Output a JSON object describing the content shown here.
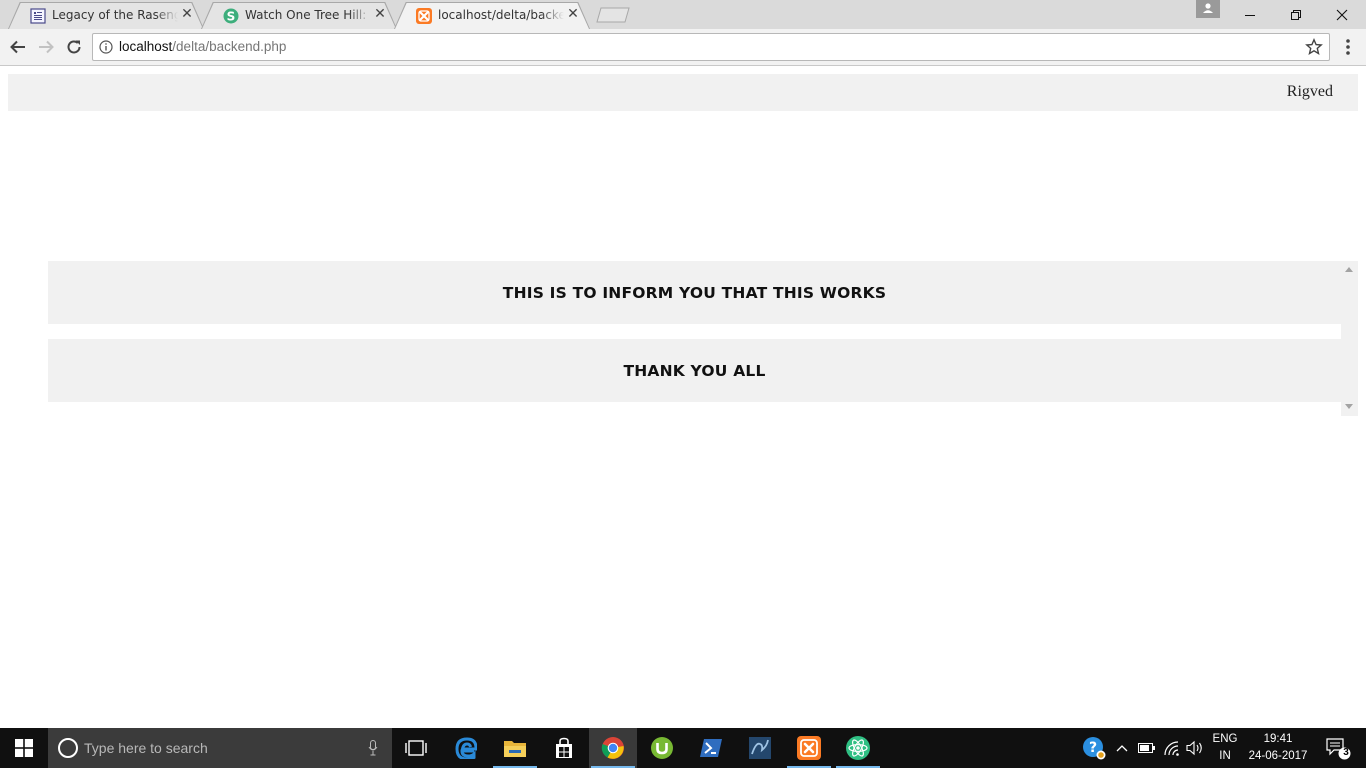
{
  "browser": {
    "tabs": [
      {
        "title": "Legacy of the Rasengan |",
        "icon": "document-icon",
        "active": false
      },
      {
        "title": "Watch One Tree Hill: Season",
        "icon": "green-s-icon",
        "active": false
      },
      {
        "title": "localhost/delta/backend.php",
        "icon": "xampp-icon",
        "active": true
      }
    ],
    "address": {
      "host": "localhost",
      "path": "/delta/backend.php"
    }
  },
  "page": {
    "nav_user": "Rigved",
    "messages": [
      "THIS IS TO INFORM YOU THAT THIS WORKS",
      "THANK YOU ALL"
    ]
  },
  "taskbar": {
    "search_placeholder": "Type here to search",
    "pinned": [
      "task-view-icon",
      "edge-icon",
      "file-explorer-icon",
      "store-icon",
      "chrome-icon",
      "utorrent-icon",
      "powershell-icon",
      "mysql-workbench-icon",
      "xampp-icon",
      "atom-icon"
    ],
    "language": "ENG",
    "region": "IN",
    "time": "19:41",
    "date": "24-06-2017",
    "notifications_count": "3"
  },
  "colors": {
    "accent": "#76b9ed",
    "page_panel": "#f1f1f1",
    "taskbar": "#101010"
  }
}
